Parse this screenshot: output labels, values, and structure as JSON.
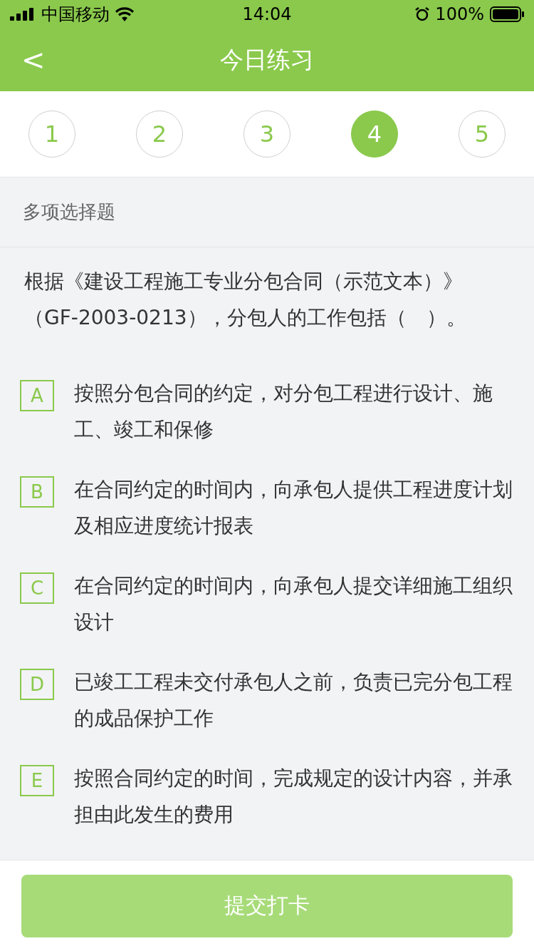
{
  "status_bar": {
    "carrier": "中国移动",
    "time": "14:04",
    "battery": "100%"
  },
  "header": {
    "back": "<",
    "title": "今日练习"
  },
  "steps": [
    {
      "label": "1",
      "selected": false
    },
    {
      "label": "2",
      "selected": false
    },
    {
      "label": "3",
      "selected": false
    },
    {
      "label": "4",
      "selected": true
    },
    {
      "label": "5",
      "selected": false
    }
  ],
  "question_type": "多项选择题",
  "question": "根据《建设工程施工专业分包合同（示范文本）》（GF-2003-0213），分包人的工作包括（　）。",
  "options": [
    {
      "letter": "A",
      "text": "按照分包合同的约定，对分包工程进行设计、施工、竣工和保修",
      "selected": false
    },
    {
      "letter": "B",
      "text": "在合同约定的时间内，向承包人提供工程进度计划及相应进度统计报表",
      "selected": false
    },
    {
      "letter": "C",
      "text": "在合同约定的时间内，向承包人提交详细施工组织设计",
      "selected": false
    },
    {
      "letter": "D",
      "text": "已竣工工程未交付承包人之前，负责已完分包工程的成品保护工作",
      "selected": false
    },
    {
      "letter": "E",
      "text": "按照合同约定的时间，完成规定的设计内容，并承担由此发生的费用",
      "selected": false
    }
  ],
  "submit": {
    "label": "提交打卡",
    "disabled": true
  }
}
